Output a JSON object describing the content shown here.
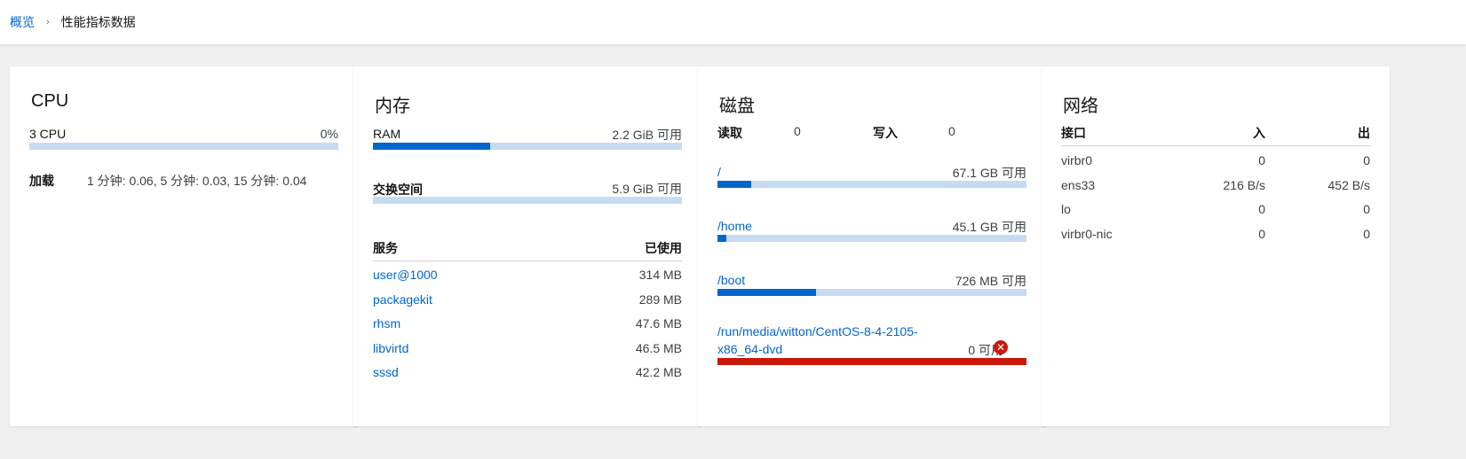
{
  "breadcrumb": {
    "overview": "概览",
    "separator": "›",
    "current": "性能指标数据"
  },
  "cpu": {
    "title": "CPU",
    "usage_label": "3 CPU",
    "usage_value": "0%",
    "usage_fraction": 0.0,
    "load_label": "加载",
    "load_value": "1 分钟: 0.06, 5 分钟: 0.03, 15 分钟: 0.04"
  },
  "memory": {
    "title": "内存",
    "ram_label": "RAM",
    "ram_value": "2.2 GiB 可用",
    "ram_used_fraction": 0.38,
    "swap_label": "交换空间",
    "swap_value": "5.9 GiB 可用",
    "swap_used_fraction": 0.0,
    "services_header": "服务",
    "used_header": "已使用",
    "services": [
      {
        "name": "user@1000",
        "used": "314 MB"
      },
      {
        "name": "packagekit",
        "used": "289 MB"
      },
      {
        "name": "rhsm",
        "used": "47.6 MB"
      },
      {
        "name": "libvirtd",
        "used": "46.5 MB"
      },
      {
        "name": "sssd",
        "used": "42.2 MB"
      }
    ]
  },
  "disk": {
    "title": "磁盘",
    "read_label": "读取",
    "read_value": "0",
    "write_label": "写入",
    "write_value": "0",
    "mounts": [
      {
        "path": "/",
        "avail": "67.1 GB 可用",
        "used_fraction": 0.11
      },
      {
        "path": "/home",
        "avail": "45.1 GB 可用",
        "used_fraction": 0.03
      },
      {
        "path": "/boot",
        "avail": "726 MB 可用",
        "used_fraction": 0.32
      }
    ],
    "media": {
      "path_line1": "/run/media/witton/CentOS-8-4-2105-",
      "path_line2": "x86_64-dvd",
      "avail": "0 可用",
      "used_fraction": 1.0,
      "status_icon": "error-circle-icon",
      "status_color": "#c9190b"
    }
  },
  "network": {
    "title": "网络",
    "col_interface": "接口",
    "col_in": "入",
    "col_out": "出",
    "interfaces": [
      {
        "name": "virbr0",
        "in": "0",
        "out": "0"
      },
      {
        "name": "ens33",
        "in": "216 B/s",
        "out": "452 B/s"
      },
      {
        "name": "lo",
        "in": "0",
        "out": "0"
      },
      {
        "name": "virbr0-nic",
        "in": "0",
        "out": "0"
      }
    ]
  },
  "colors": {
    "accent": "#0066cc",
    "track": "#c6dcf1",
    "danger": "#c9190b"
  }
}
